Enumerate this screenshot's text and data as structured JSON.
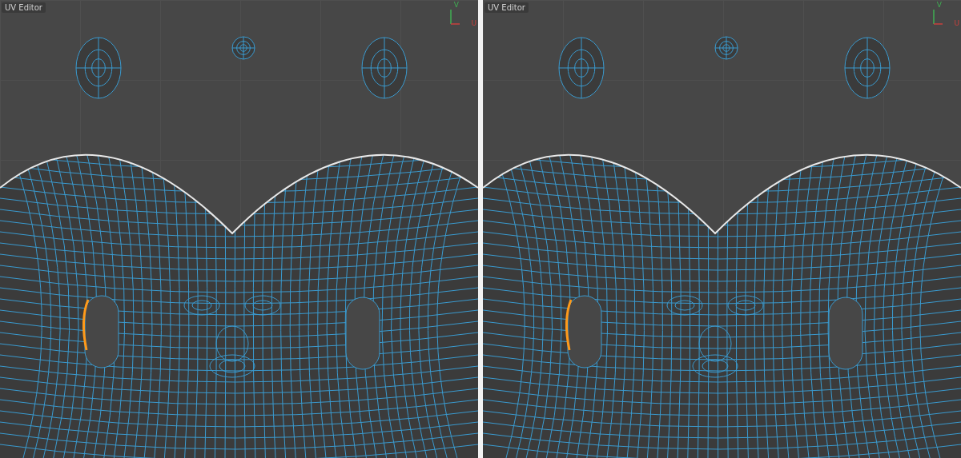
{
  "panels": [
    {
      "title": "UV Editor",
      "axis_v": "V",
      "axis_u": "U"
    },
    {
      "title": "UV Editor",
      "axis_v": "V",
      "axis_u": "U"
    }
  ]
}
